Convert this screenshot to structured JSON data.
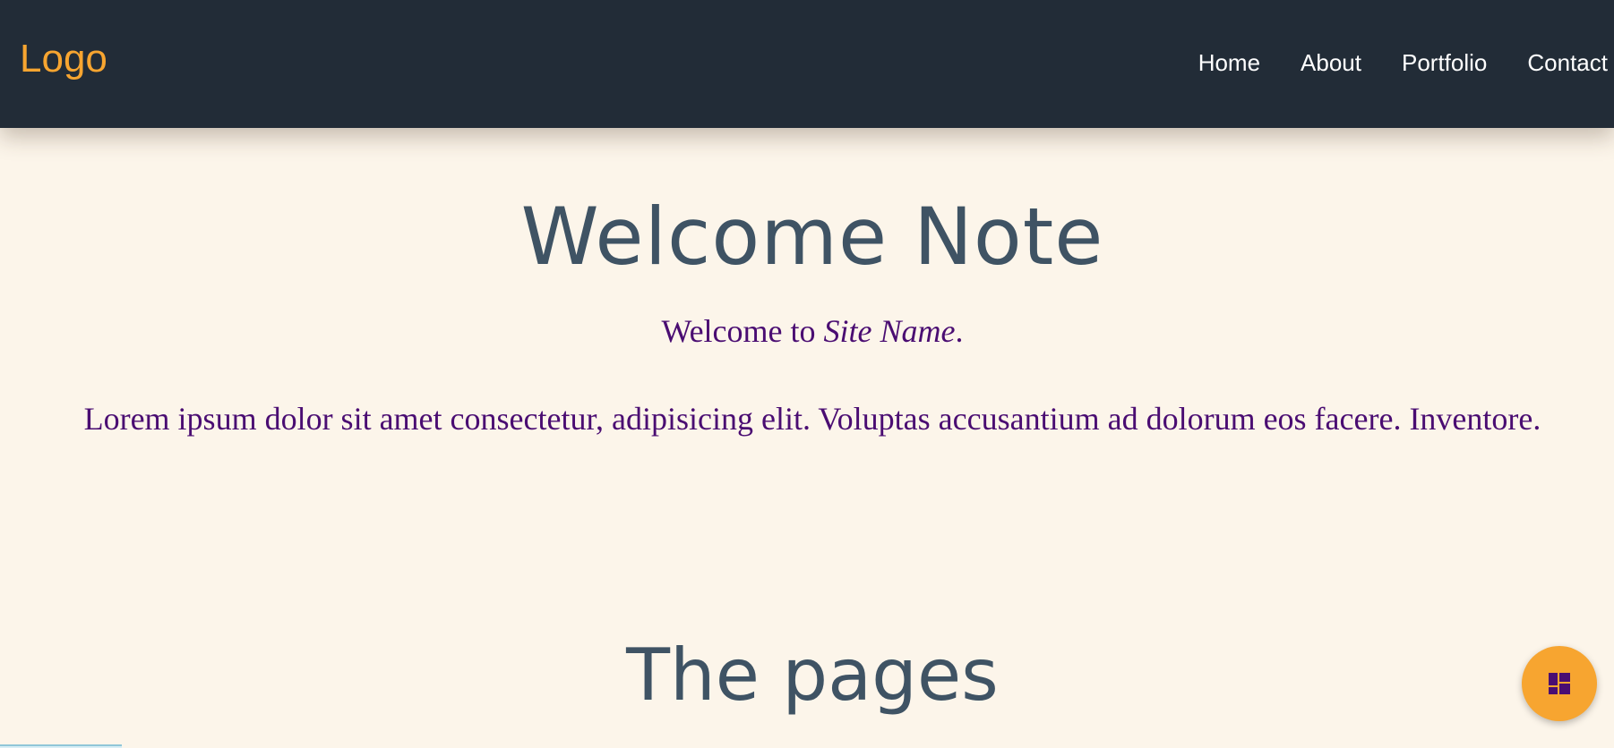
{
  "nav": {
    "logo": "Logo",
    "links": [
      {
        "label": "Home"
      },
      {
        "label": "About"
      },
      {
        "label": "Portfolio"
      },
      {
        "label": "Contact"
      }
    ]
  },
  "main": {
    "heading": "Welcome Note",
    "welcome_prefix": "Welcome to ",
    "site_name": "Site Name",
    "welcome_suffix": ".",
    "paragraph": "Lorem ipsum dolor sit amet consectetur, adipisicing elit. Voluptas accusantium ad dolorum eos facere. Inventore.",
    "section_heading": "The pages"
  },
  "fab": {
    "icon": "dashboard-icon"
  },
  "colors": {
    "navbar_bg": "#222c37",
    "logo": "#f7a530",
    "page_bg": "#fcf5ea",
    "heading": "#3f5364",
    "body_text": "#4a0d72",
    "fab_bg": "#f7a530",
    "fab_icon": "#4a0d72"
  }
}
